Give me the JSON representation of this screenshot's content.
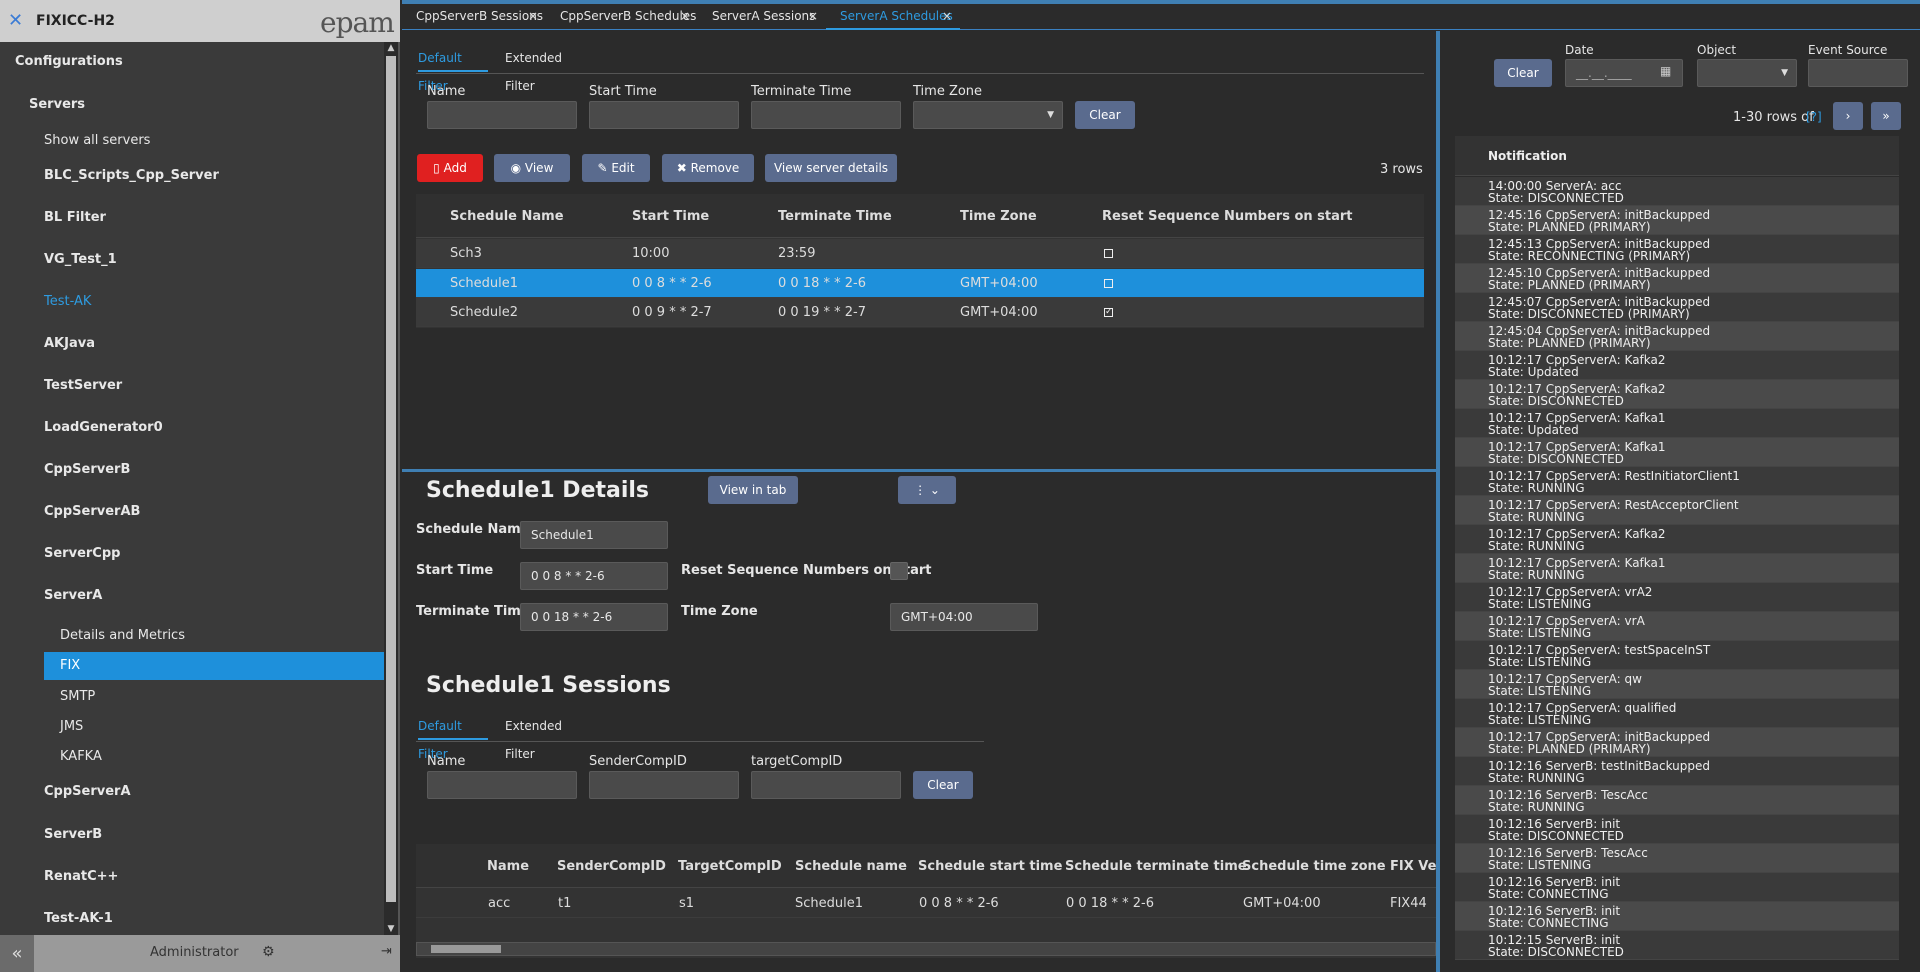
{
  "app": {
    "title": "FIXICC-H2",
    "brand": "epam"
  },
  "sidebar": {
    "items": [
      {
        "label": "Configurations"
      },
      {
        "label": "Servers"
      },
      {
        "label": "Show all servers"
      },
      {
        "label": "BLC_Scripts_Cpp_Server"
      },
      {
        "label": "BL Filter"
      },
      {
        "label": "VG_Test_1"
      },
      {
        "label": "Test-AK"
      },
      {
        "label": "AKJava"
      },
      {
        "label": "TestServer"
      },
      {
        "label": "LoadGenerator0"
      },
      {
        "label": "CppServerB"
      },
      {
        "label": "CppServerAB"
      },
      {
        "label": "ServerCpp"
      },
      {
        "label": "ServerA"
      },
      {
        "label": "Details and Metrics"
      },
      {
        "label": "FIX"
      },
      {
        "label": "SMTP"
      },
      {
        "label": "JMS"
      },
      {
        "label": "KAFKA"
      },
      {
        "label": "CppServerA"
      },
      {
        "label": "ServerB"
      },
      {
        "label": "RenatC++"
      },
      {
        "label": "Test-AK-1"
      }
    ],
    "footer": {
      "user": "Administrator"
    }
  },
  "tabs": [
    {
      "label": "CppServerB Sessions"
    },
    {
      "label": "CppServerB Schedules"
    },
    {
      "label": "ServerA Sessions"
    },
    {
      "label": "ServerA Schedules"
    }
  ],
  "tab_close": "×",
  "schedules": {
    "filter_tabs": [
      "Default Filter",
      "Extended Filter"
    ],
    "filters": {
      "name": "Name",
      "start_time": "Start Time",
      "terminate_time": "Terminate Time",
      "time_zone": "Time Zone",
      "clear": "Clear"
    },
    "toolbar": {
      "add": "Add",
      "view": "View",
      "edit": "Edit",
      "remove": "Remove",
      "view_server": "View server details",
      "rows": "3 rows"
    },
    "columns": [
      "Schedule Name",
      "Start Time",
      "Terminate Time",
      "Time Zone",
      "Reset Sequence Numbers on start"
    ],
    "rows": [
      {
        "name": "Sch3",
        "start": "10:00",
        "terminate": "23:59",
        "tz": "",
        "reset": false
      },
      {
        "name": "Schedule1",
        "start": "0 0 8 * * 2-6",
        "terminate": "0 0 18 * * 2-6",
        "tz": "GMT+04:00",
        "reset": false
      },
      {
        "name": "Schedule2",
        "start": "0 0 9 * * 2-7",
        "terminate": "0 0 19 * * 2-7",
        "tz": "GMT+04:00",
        "reset": true
      }
    ]
  },
  "details": {
    "title": "Schedule1 Details",
    "view_in_tab": "View in tab",
    "labels": {
      "schedule_name": "Schedule Name",
      "start_time": "Start Time",
      "terminate_time": "Terminate Time",
      "reset": "Reset Sequence Numbers on start",
      "time_zone": "Time Zone"
    },
    "values": {
      "schedule_name": "Schedule1",
      "start_time": "0 0 8 * * 2-6",
      "terminate_time": "0 0 18 * * 2-6",
      "time_zone": "GMT+04:00"
    }
  },
  "sessions": {
    "title": "Schedule1 Sessions",
    "filter_tabs": [
      "Default Filter",
      "Extended Filter"
    ],
    "filters": {
      "name": "Name",
      "sender": "SenderCompID",
      "target": "targetCompID",
      "clear": "Clear"
    },
    "columns": [
      "Name",
      "SenderCompID",
      "TargetCompID",
      "Schedule name",
      "Schedule start time",
      "Schedule terminate time",
      "Schedule time zone",
      "FIX Versi"
    ],
    "rows": [
      {
        "name": "acc",
        "sender": "t1",
        "target": "s1",
        "schedule": "Schedule1",
        "start": "0 0 8 * * 2-6",
        "terminate": "0 0 18 * * 2-6",
        "tz": "GMT+04:00",
        "fix": "FIX44"
      }
    ]
  },
  "events": {
    "clear": "Clear",
    "date_label": "Date",
    "date_placeholder": "__.__.____",
    "object_label": "Object",
    "source_label": "Event Source",
    "pager": "1-30 rows of",
    "pager_link": "[?]",
    "column": "Notification",
    "items": [
      {
        "l1": "14:00:00 ServerA: acc",
        "l2": "State: DISCONNECTED"
      },
      {
        "l1": "12:45:16 CppServerA: initBackupped",
        "l2": "State: PLANNED (PRIMARY)"
      },
      {
        "l1": "12:45:13 CppServerA: initBackupped",
        "l2": "State: RECONNECTING (PRIMARY)"
      },
      {
        "l1": "12:45:10 CppServerA: initBackupped",
        "l2": "State: PLANNED (PRIMARY)"
      },
      {
        "l1": "12:45:07 CppServerA: initBackupped",
        "l2": "State: DISCONNECTED (PRIMARY)"
      },
      {
        "l1": "12:45:04 CppServerA: initBackupped",
        "l2": "State: PLANNED (PRIMARY)"
      },
      {
        "l1": "10:12:17 CppServerA: Kafka2",
        "l2": "State: Updated"
      },
      {
        "l1": "10:12:17 CppServerA: Kafka2",
        "l2": "State: DISCONNECTED"
      },
      {
        "l1": "10:12:17 CppServerA: Kafka1",
        "l2": "State: Updated"
      },
      {
        "l1": "10:12:17 CppServerA: Kafka1",
        "l2": "State: DISCONNECTED"
      },
      {
        "l1": "10:12:17 CppServerA: RestInitiatorClient1",
        "l2": "State: RUNNING"
      },
      {
        "l1": "10:12:17 CppServerA: RestAcceptorClient",
        "l2": "State: RUNNING"
      },
      {
        "l1": "10:12:17 CppServerA: Kafka2",
        "l2": "State: RUNNING"
      },
      {
        "l1": "10:12:17 CppServerA: Kafka1",
        "l2": "State: RUNNING"
      },
      {
        "l1": "10:12:17 CppServerA: vrA2",
        "l2": "State: LISTENING"
      },
      {
        "l1": "10:12:17 CppServerA: vrA",
        "l2": "State: LISTENING"
      },
      {
        "l1": "10:12:17 CppServerA: testSpaceInST",
        "l2": "State: LISTENING"
      },
      {
        "l1": "10:12:17 CppServerA: qw",
        "l2": "State: LISTENING"
      },
      {
        "l1": "10:12:17 CppServerA: qualified",
        "l2": "State: LISTENING"
      },
      {
        "l1": "10:12:17 CppServerA: initBackupped",
        "l2": "State: PLANNED (PRIMARY)"
      },
      {
        "l1": "10:12:16 ServerB: testInitBackupped",
        "l2": "State: RUNNING"
      },
      {
        "l1": "10:12:16 ServerB: TescAcc",
        "l2": "State: RUNNING"
      },
      {
        "l1": "10:12:16 ServerB: init",
        "l2": "State: DISCONNECTED"
      },
      {
        "l1": "10:12:16 ServerB: TescAcc",
        "l2": "State: LISTENING"
      },
      {
        "l1": "10:12:16 ServerB: init",
        "l2": "State: CONNECTING"
      },
      {
        "l1": "10:12:16 ServerB: init",
        "l2": "State: CONNECTING"
      },
      {
        "l1": "10:12:15 ServerB: init",
        "l2": "State: DISCONNECTED"
      }
    ]
  },
  "colors": {
    "accent": "#1e90db",
    "danger": "#e02020",
    "button": "#5a6b8e"
  }
}
